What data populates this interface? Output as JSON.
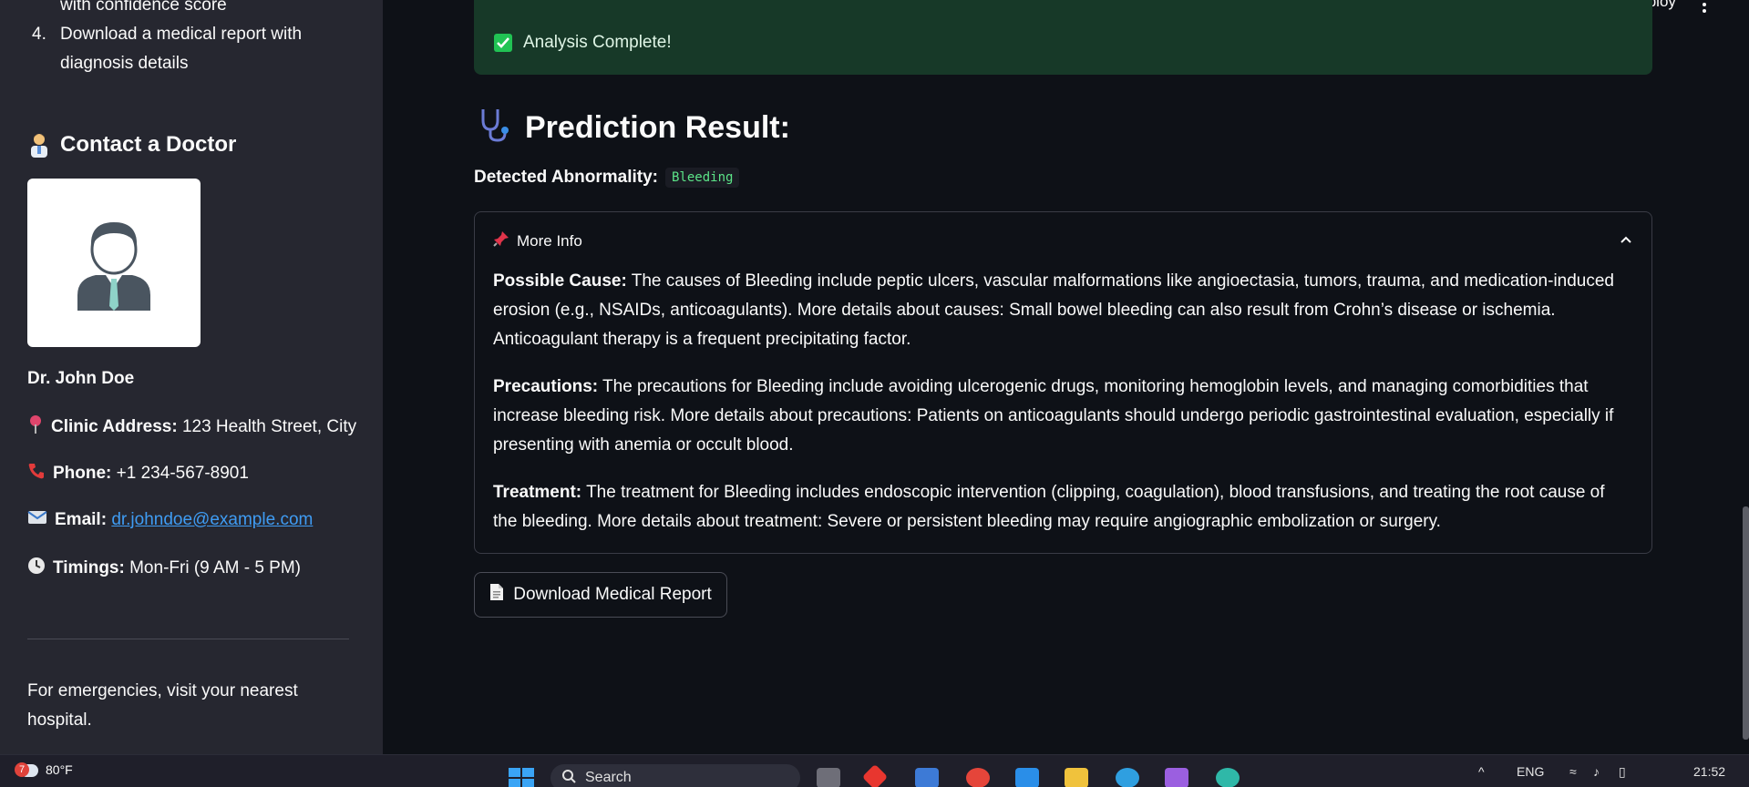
{
  "sidebar": {
    "steps": [
      {
        "num": "",
        "text": "with confidence score"
      },
      {
        "num": "4.",
        "text": "Download a medical report with diagnosis details"
      }
    ],
    "contact_heading": "Contact a Doctor",
    "doctor_name": "Dr. John Doe",
    "address_label": "Clinic Address:",
    "address_value": "123 Health Street, City",
    "phone_label": "Phone:",
    "phone_value": "+1 234-567-8901",
    "email_label": "Email:",
    "email_value": "dr.johndoe@example.com",
    "timings_label": "Timings:",
    "timings_value": "Mon-Fri (9 AM - 5 PM)",
    "emergency_text": "For emergencies, visit your nearest hospital."
  },
  "header": {
    "deploy_label": "Deploy"
  },
  "main": {
    "success_text": "Analysis Complete!",
    "result_title": "Prediction Result:",
    "abnormality_label": "Detected Abnormality:",
    "abnormality_value": "Bleeding",
    "expander": {
      "title": "More Info",
      "cause_label": "Possible Cause:",
      "cause_text": " The causes of Bleeding include peptic ulcers, vascular malformations like angioectasia, tumors, trauma, and medication-induced erosion (e.g., NSAIDs, anticoagulants). More details about causes: Small bowel bleeding can also result from Crohn’s disease or ischemia. Anticoagulant therapy is a frequent precipitating factor.",
      "precautions_label": "Precautions:",
      "precautions_text": " The precautions for Bleeding include avoiding ulcerogenic drugs, monitoring hemoglobin levels, and managing comorbidities that increase bleeding risk. More details about precautions: Patients on anticoagulants should undergo periodic gastrointestinal evaluation, especially if presenting with anemia or occult blood.",
      "treatment_label": "Treatment:",
      "treatment_text": " The treatment for Bleeding includes endoscopic intervention (clipping, coagulation), blood transfusions, and treating the root cause of the bleeding. More details about treatment: Severe or persistent bleeding may require angiographic embolization or surgery."
    },
    "download_label": "Download Medical Report"
  },
  "taskbar": {
    "weather_badge": "7",
    "temperature": "80°F",
    "search_placeholder": "Search",
    "language": "ENG",
    "time": "21:52"
  },
  "colors": {
    "page_bg": "#0e1117",
    "sidebar_bg": "#262730",
    "success_bg": "#173928",
    "accent_green": "#21c354",
    "link_blue": "#3f9cf3"
  }
}
